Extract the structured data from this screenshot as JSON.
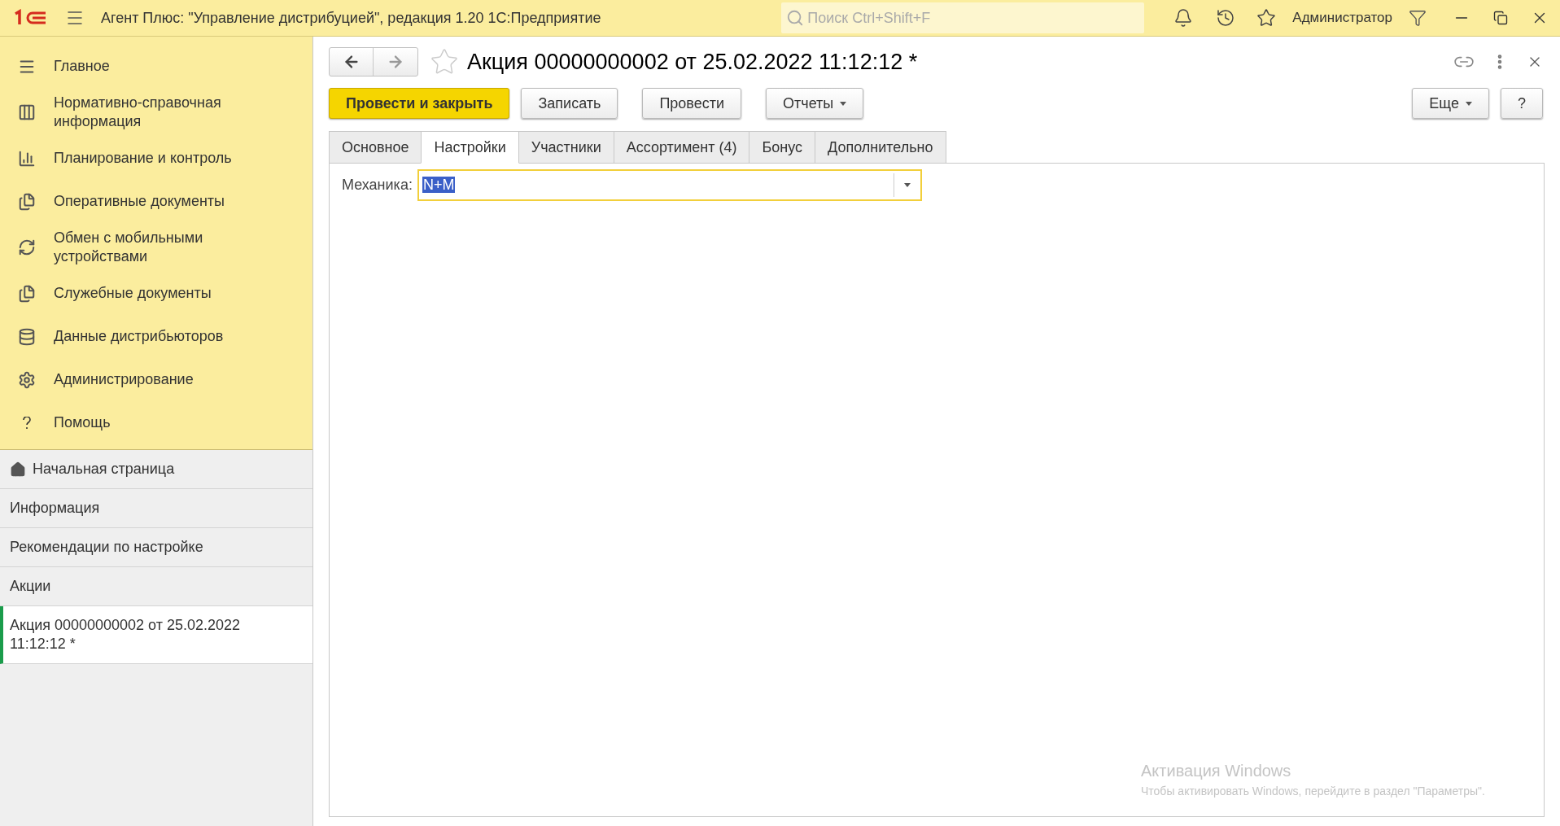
{
  "window": {
    "title": "Агент Плюс: \"Управление дистрибуцией\", редакция 1.20 1С:Предприятие",
    "search_placeholder": "Поиск Ctrl+Shift+F",
    "user": "Администратор"
  },
  "sections": [
    {
      "label": "Главное"
    },
    {
      "label": "Нормативно-справочная информация"
    },
    {
      "label": "Планирование и контроль"
    },
    {
      "label": "Оперативные документы"
    },
    {
      "label": "Обмен с мобильными устройствами"
    },
    {
      "label": "Служебные документы"
    },
    {
      "label": "Данные дистрибьюторов"
    },
    {
      "label": "Администрирование"
    },
    {
      "label": "Помощь"
    }
  ],
  "open_windows": [
    {
      "label": "Начальная страница",
      "selected": false
    },
    {
      "label": "Информация",
      "selected": false
    },
    {
      "label": "Рекомендации по настройке",
      "selected": false
    },
    {
      "label": "Акции",
      "selected": false
    },
    {
      "label": "Акция 00000000002 от 25.02.2022 11:12:12 *",
      "selected": true
    }
  ],
  "document": {
    "title": "Акция 00000000002 от 25.02.2022 11:12:12 *",
    "buttons": [
      {
        "label": "Провести и закрыть",
        "kind": "primary"
      },
      {
        "label": "Записать",
        "kind": "plain"
      },
      {
        "label": "Провести",
        "kind": "plain"
      },
      {
        "label": "Отчеты",
        "kind": "dropdown"
      }
    ],
    "right_buttons": [
      {
        "label": "Еще",
        "kind": "dropdown"
      },
      {
        "label": "?",
        "kind": "plain"
      }
    ],
    "tabs": [
      {
        "label": "Основное",
        "selected": false
      },
      {
        "label": "Настройки",
        "selected": true
      },
      {
        "label": "Участники",
        "selected": false
      },
      {
        "label": "Ассортимент (4)",
        "selected": false
      },
      {
        "label": "Бонус",
        "selected": false
      },
      {
        "label": "Дополнительно",
        "selected": false
      }
    ],
    "field": {
      "label": "Механика:",
      "value": "N+M"
    }
  },
  "os_overlay": {
    "title": "Активация Windows",
    "text": "Чтобы активировать Windows, перейдите в раздел \"Параметры\"."
  }
}
